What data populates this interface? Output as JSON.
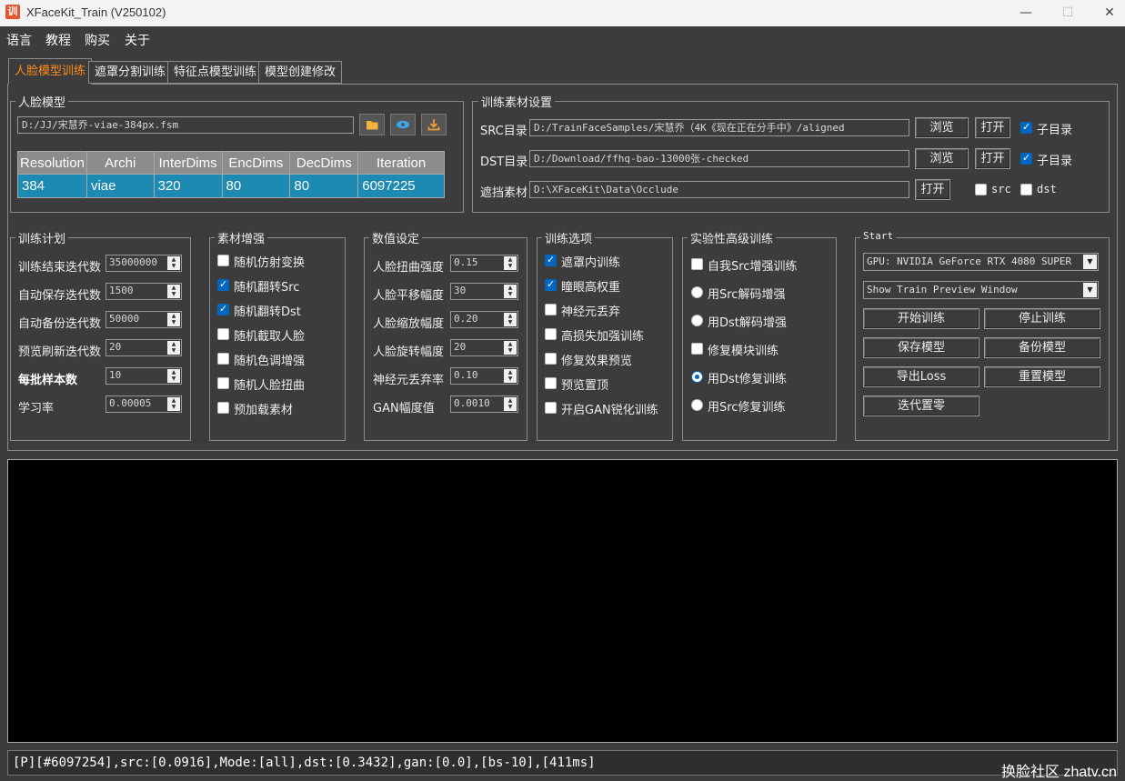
{
  "window": {
    "title": "XFaceKit_Train (V250102)",
    "icon_text": "训",
    "minimize": "—",
    "maximize": "☐",
    "close": "✕"
  },
  "menu": [
    "语言",
    "教程",
    "购买",
    "关于"
  ],
  "tabs": [
    "人脸模型训练",
    "遮罩分割训练",
    "特征点模型训练",
    "模型创建修改"
  ],
  "face_model": {
    "group_title": "人脸模型",
    "path": "D:/JJ/宋慧乔-viae-384px.fsm",
    "columns": [
      "Resolution",
      "Archi",
      "InterDims",
      "EncDims",
      "DecDims",
      "Iteration"
    ],
    "row": [
      "384",
      "viae",
      "320",
      "80",
      "80",
      "6097225"
    ]
  },
  "material": {
    "group_title": "训练素材设置",
    "src_label": "SRC目录",
    "src_path": "D:/TrainFaceSamples/宋慧乔（4K《现在正在分手中》/aligned",
    "dst_label": "DST目录",
    "dst_path": "D:/Download/ffhq-bao-13000张-checked",
    "occ_label": "遮挡素材",
    "occ_path": "D:\\XFaceKit\\Data\\Occlude",
    "browse": "浏览",
    "open": "打开",
    "subdir": "子目录",
    "src_chk": "src",
    "dst_chk": "dst"
  },
  "plan": {
    "group_title": "训练计划",
    "rows": [
      {
        "label": "训练结束迭代数",
        "value": "35000000"
      },
      {
        "label": "自动保存迭代数",
        "value": "1500"
      },
      {
        "label": "自动备份迭代数",
        "value": "50000"
      },
      {
        "label": "预览刷新迭代数",
        "value": "20"
      },
      {
        "label": "每批样本数",
        "value": "10"
      },
      {
        "label": "学习率",
        "value": "0.00005"
      }
    ]
  },
  "augment": {
    "group_title": "素材增强",
    "items": [
      {
        "label": "随机仿射变换",
        "checked": false
      },
      {
        "label": "随机翻转Src",
        "checked": true
      },
      {
        "label": "随机翻转Dst",
        "checked": true
      },
      {
        "label": "随机截取人脸",
        "checked": false
      },
      {
        "label": "随机色调增强",
        "checked": false
      },
      {
        "label": "随机人脸扭曲",
        "checked": false
      },
      {
        "label": "预加载素材",
        "checked": false
      }
    ]
  },
  "values": {
    "group_title": "数值设定",
    "rows": [
      {
        "label": "人脸扭曲强度",
        "value": "0.15"
      },
      {
        "label": "人脸平移幅度",
        "value": "30"
      },
      {
        "label": "人脸缩放幅度",
        "value": "0.20"
      },
      {
        "label": "人脸旋转幅度",
        "value": "20"
      },
      {
        "label": "神经元丢弃率",
        "value": "0.10"
      },
      {
        "label": "GAN幅度值",
        "value": "0.0010"
      }
    ]
  },
  "options": {
    "group_title": "训练选项",
    "items": [
      {
        "label": "遮罩内训练",
        "checked": true
      },
      {
        "label": "瞳眼高权重",
        "checked": true
      },
      {
        "label": "神经元丢弃",
        "checked": false
      },
      {
        "label": "高损失加强训练",
        "checked": false
      },
      {
        "label": "修复效果预览",
        "checked": false
      },
      {
        "label": "预览置顶",
        "checked": false
      },
      {
        "label": "开启GAN锐化训练",
        "checked": false
      }
    ]
  },
  "advanced": {
    "group_title": "实验性高级训练",
    "items": [
      {
        "label": "自我Src增强训练",
        "kind": "checkbox",
        "checked": false
      },
      {
        "label": "用Src解码增强",
        "kind": "radio",
        "checked": false
      },
      {
        "label": "用Dst解码增强",
        "kind": "radio",
        "checked": false
      },
      {
        "label": "修复模块训练",
        "kind": "checkbox",
        "checked": false
      },
      {
        "label": "用Dst修复训练",
        "kind": "radio",
        "checked": true
      },
      {
        "label": "用Src修复训练",
        "kind": "radio",
        "checked": false
      }
    ]
  },
  "start": {
    "group_title": "Start",
    "gpu": "GPU: NVIDIA GeForce RTX 4080 SUPER",
    "preview_mode": "Show Train Preview Window",
    "buttons": [
      "开始训练",
      "停止训练",
      "保存模型",
      "备份模型",
      "导出Loss",
      "重置模型",
      "迭代置零"
    ]
  },
  "status": "[P][#6097254],src:[0.0916],Mode:[all],dst:[0.3432],gan:[0.0],[bs-10],[411ms]",
  "watermark": "换脸社区 zhatv.cn"
}
